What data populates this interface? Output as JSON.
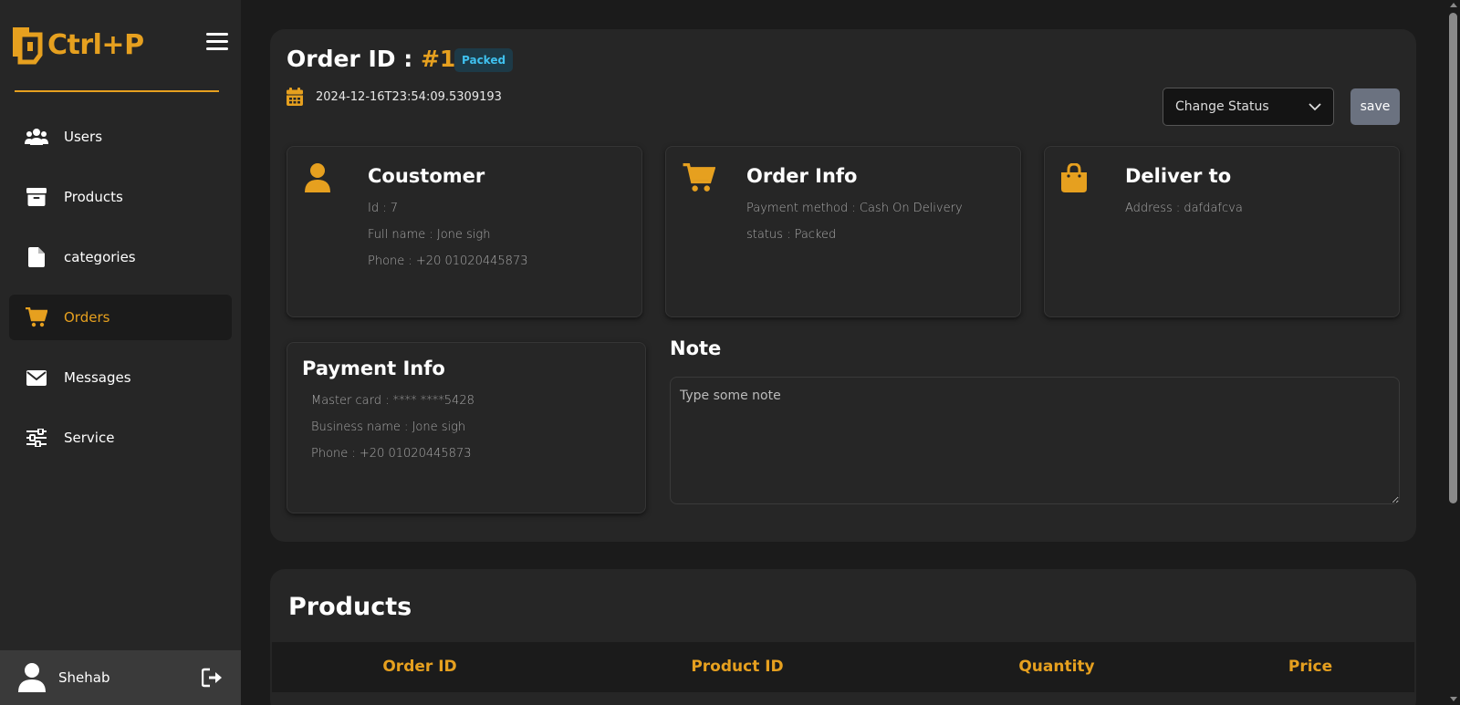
{
  "brand": {
    "name": "Ctrl+P",
    "accent_color": "#e6a01f"
  },
  "sidebar": {
    "items": [
      {
        "label": "Users",
        "icon": "users-icon",
        "active": false
      },
      {
        "label": "Products",
        "icon": "archive-box-icon",
        "active": false
      },
      {
        "label": "categories",
        "icon": "file-icon",
        "active": false
      },
      {
        "label": "Orders",
        "icon": "cart-icon",
        "active": true
      },
      {
        "label": "Messages",
        "icon": "envelope-icon",
        "active": false
      },
      {
        "label": "Service",
        "icon": "sliders-icon",
        "active": false
      }
    ],
    "user": {
      "name": "Shehab",
      "avatar_icon": "user-avatar-icon",
      "logout_icon": "logout-icon"
    }
  },
  "order": {
    "title_prefix": "Order ID :",
    "id": "#1",
    "status_badge": "Packed",
    "date": "2024-12-16T23:54:09.5309193",
    "status_select_placeholder": "Change Status",
    "save_label": "save"
  },
  "customer": {
    "title": "Coustomer",
    "lines": [
      "Id : 7",
      "Full name : Jone sigh",
      "Phone : +20 01020445873"
    ]
  },
  "order_info": {
    "title": "Order Info",
    "lines": [
      "Payment method : Cash On Delivery",
      "status : Packed"
    ]
  },
  "deliver": {
    "title": "Deliver to",
    "lines": [
      "Address : dafdafcva"
    ]
  },
  "payment": {
    "title": "Payment Info",
    "lines": [
      "Master card : **** ****5428",
      "Business name : Jone sigh",
      "Phone : +20 01020445873"
    ]
  },
  "note": {
    "label": "Note",
    "placeholder": "Type some note"
  },
  "products": {
    "title": "Products",
    "columns": [
      "Order ID",
      "Product ID",
      "Quantity",
      "Price"
    ]
  }
}
